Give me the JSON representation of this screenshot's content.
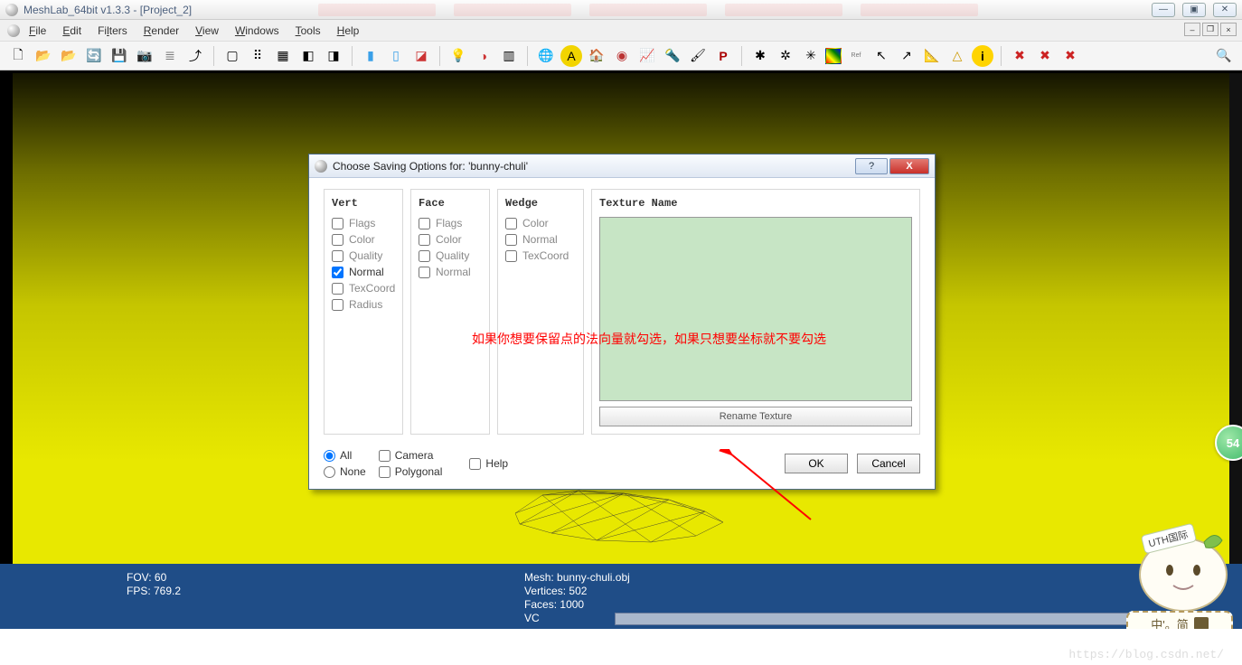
{
  "window": {
    "title": "MeshLab_64bit v1.3.3 - [Project_2]"
  },
  "menu": {
    "items": [
      "File",
      "Edit",
      "Filters",
      "Render",
      "View",
      "Windows",
      "Tools",
      "Help"
    ]
  },
  "dialog": {
    "title": "Choose Saving Options for: 'bunny-chuli'",
    "groups": {
      "vert": {
        "label": "Vert",
        "items": [
          "Flags",
          "Color",
          "Quality",
          "Normal",
          "TexCoord",
          "Radius"
        ],
        "checked": "Normal"
      },
      "face": {
        "label": "Face",
        "items": [
          "Flags",
          "Color",
          "Quality",
          "Normal"
        ]
      },
      "wedge": {
        "label": "Wedge",
        "items": [
          "Color",
          "Normal",
          "TexCoord"
        ]
      },
      "texture": {
        "label": "Texture Name",
        "rename": "Rename Texture"
      }
    },
    "bottom": {
      "all": "All",
      "none": "None",
      "camera": "Camera",
      "polygonal": "Polygonal",
      "help": "Help",
      "ok": "OK",
      "cancel": "Cancel"
    }
  },
  "annotation": "如果你想要保留点的法向量就勾选，如果只想要坐标就不要勾选",
  "info": {
    "fov": "FOV: 60",
    "fps": "FPS:   769.2",
    "mesh": "Mesh: bunny-chuli.obj",
    "vertices": "Vertices: 502",
    "faces": "Faces: 1000",
    "vc": "VC"
  },
  "badge": "54",
  "mascot_label": "UTH国际",
  "ime": "中'。简",
  "watermark": "https://blog.csdn.net/"
}
